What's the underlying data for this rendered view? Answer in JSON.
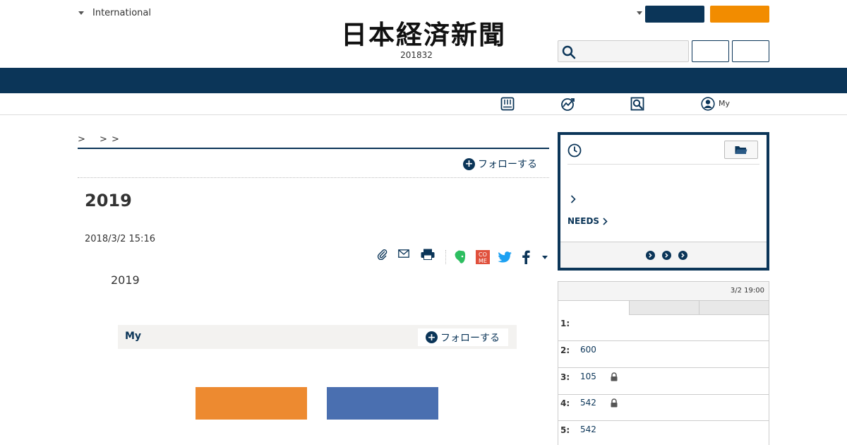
{
  "header": {
    "edition_label": "International",
    "logo_text": "日本経済新聞",
    "issue_number": "201832",
    "search_placeholder": ""
  },
  "subnav": {
    "my_label": "My"
  },
  "article": {
    "breadcrumb": ">　 > >",
    "follow_label": "フォローする",
    "title": "2019",
    "date": "2018/3/2 15:16",
    "lead": "2019"
  },
  "follow_box": {
    "label": "My",
    "follow_label": "フォローする"
  },
  "side_panel": {
    "needs_label": "NEEDS"
  },
  "ranking": {
    "updated": "3/2 19:00",
    "rows": [
      {
        "rank": "1:",
        "value": "",
        "locked": false
      },
      {
        "rank": "2:",
        "value": "600",
        "locked": false
      },
      {
        "rank": "3:",
        "value": "105",
        "locked": true
      },
      {
        "rank": "4:",
        "value": "542",
        "locked": true
      },
      {
        "rank": "5:",
        "value": "542",
        "locked": false
      }
    ]
  },
  "colors": {
    "navy": "#0b3558",
    "orange": "#f28c00",
    "ad_orange": "#ed8a30",
    "ad_blue": "#4a6fb0"
  },
  "share_icons": [
    "clip-icon",
    "mail-icon",
    "print-icon",
    "evernote-icon",
    "comment-icon",
    "twitter-icon",
    "facebook-icon",
    "more-caret-icon"
  ]
}
